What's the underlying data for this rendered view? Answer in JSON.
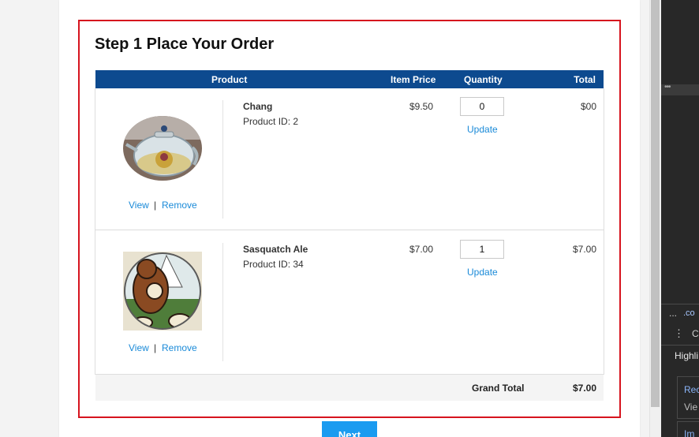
{
  "order": {
    "title": "Step 1 Place Your Order",
    "columns": {
      "product": "Product",
      "item_price": "Item Price",
      "quantity": "Quantity",
      "total": "Total"
    },
    "items": [
      {
        "name": "Chang",
        "product_id": "Product ID: 2",
        "price": "$9.50",
        "quantity": "0",
        "total": "$00",
        "view_label": "View",
        "separator": "|",
        "remove_label": "Remove",
        "update_label": "Update",
        "image_icon": "teapot-image"
      },
      {
        "name": "Sasquatch Ale",
        "product_id": "Product ID: 34",
        "price": "$7.00",
        "quantity": "1",
        "total": "$7.00",
        "view_label": "View",
        "separator": "|",
        "remove_label": "Remove",
        "update_label": "Update",
        "image_icon": "sasquatch-image"
      }
    ],
    "grand_total_label": "Grand Total",
    "grand_total_value": "$7.00",
    "next_label": "Next"
  },
  "devtools": {
    "ellipsis": "•••",
    "ellipsis2": "...",
    "domain_fragment": ".co",
    "kebab": "⋮",
    "c_fragment": "C",
    "highlight_fragment": "Highli",
    "rec_fragment": "Rec",
    "view_fragment": "Vie",
    "im_fragment": "Im"
  },
  "colors": {
    "header_blue": "#0d4a8f",
    "order_border_red": "#d6141e",
    "link_blue": "#1a8ad8",
    "button_blue": "#1a9bf0"
  }
}
